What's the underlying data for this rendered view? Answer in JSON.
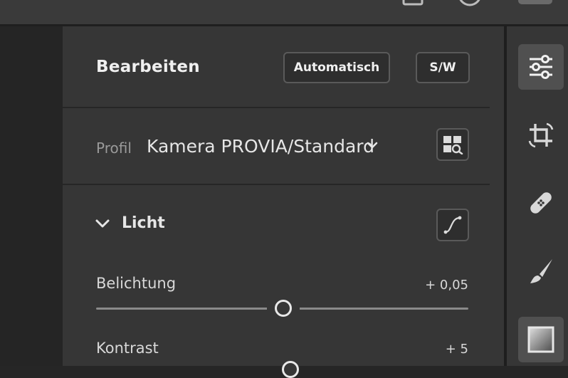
{
  "panel": {
    "title": "Bearbeiten",
    "auto_button": "Automatisch",
    "bw_button": "S/W"
  },
  "profile": {
    "label": "Profil",
    "value": "Kamera PROVIA/Standard"
  },
  "section": {
    "title": "Licht"
  },
  "sliders": [
    {
      "label": "Belichtung",
      "value": "+ 0,05",
      "position": 0.508
    },
    {
      "label": "Kontrast",
      "value": "+ 5",
      "position": 0.52
    }
  ],
  "rail": {
    "items": [
      "edit-sliders-icon",
      "crop-rotate-icon",
      "healing-bandage-icon",
      "brush-icon",
      "gradient-mask-icon"
    ],
    "active": "edit-sliders-icon"
  },
  "colors": {
    "panel_bg": "#363636",
    "button_bg": "#2e2e2e",
    "active_rail_bg": "#505050",
    "text": "#e6e6e6"
  }
}
